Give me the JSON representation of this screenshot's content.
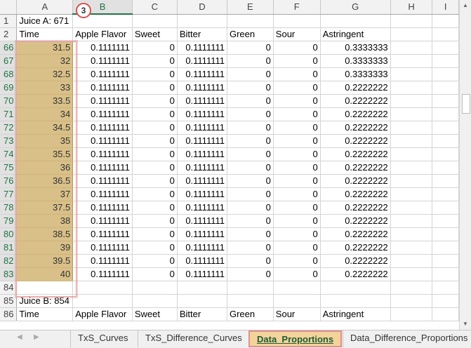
{
  "columns": [
    "A",
    "B",
    "C",
    "D",
    "E",
    "F",
    "G",
    "H",
    "I"
  ],
  "annotation_badge": "3",
  "header_rows": [
    {
      "row": "1",
      "cells": [
        "Juice A: 671",
        "",
        "",
        "",
        "",
        "",
        "",
        "",
        ""
      ]
    },
    {
      "row": "2",
      "cells": [
        "Time",
        "Apple Flavor",
        "Sweet",
        "Bitter",
        "Green",
        "Sour",
        "Astringent",
        "",
        ""
      ]
    }
  ],
  "data_rows": [
    {
      "row": "66",
      "time": "31.5",
      "apple": "0.1111111",
      "sweet": "0",
      "bitter": "0.1111111",
      "green": "0",
      "sour": "0",
      "astringent": "0.3333333"
    },
    {
      "row": "67",
      "time": "32",
      "apple": "0.1111111",
      "sweet": "0",
      "bitter": "0.1111111",
      "green": "0",
      "sour": "0",
      "astringent": "0.3333333"
    },
    {
      "row": "68",
      "time": "32.5",
      "apple": "0.1111111",
      "sweet": "0",
      "bitter": "0.1111111",
      "green": "0",
      "sour": "0",
      "astringent": "0.3333333"
    },
    {
      "row": "69",
      "time": "33",
      "apple": "0.1111111",
      "sweet": "0",
      "bitter": "0.1111111",
      "green": "0",
      "sour": "0",
      "astringent": "0.2222222"
    },
    {
      "row": "70",
      "time": "33.5",
      "apple": "0.1111111",
      "sweet": "0",
      "bitter": "0.1111111",
      "green": "0",
      "sour": "0",
      "astringent": "0.2222222"
    },
    {
      "row": "71",
      "time": "34",
      "apple": "0.1111111",
      "sweet": "0",
      "bitter": "0.1111111",
      "green": "0",
      "sour": "0",
      "astringent": "0.2222222"
    },
    {
      "row": "72",
      "time": "34.5",
      "apple": "0.1111111",
      "sweet": "0",
      "bitter": "0.1111111",
      "green": "0",
      "sour": "0",
      "astringent": "0.2222222"
    },
    {
      "row": "73",
      "time": "35",
      "apple": "0.1111111",
      "sweet": "0",
      "bitter": "0.1111111",
      "green": "0",
      "sour": "0",
      "astringent": "0.2222222"
    },
    {
      "row": "74",
      "time": "35.5",
      "apple": "0.1111111",
      "sweet": "0",
      "bitter": "0.1111111",
      "green": "0",
      "sour": "0",
      "astringent": "0.2222222"
    },
    {
      "row": "75",
      "time": "36",
      "apple": "0.1111111",
      "sweet": "0",
      "bitter": "0.1111111",
      "green": "0",
      "sour": "0",
      "astringent": "0.2222222"
    },
    {
      "row": "76",
      "time": "36.5",
      "apple": "0.1111111",
      "sweet": "0",
      "bitter": "0.1111111",
      "green": "0",
      "sour": "0",
      "astringent": "0.2222222"
    },
    {
      "row": "77",
      "time": "37",
      "apple": "0.1111111",
      "sweet": "0",
      "bitter": "0.1111111",
      "green": "0",
      "sour": "0",
      "astringent": "0.2222222"
    },
    {
      "row": "78",
      "time": "37.5",
      "apple": "0.1111111",
      "sweet": "0",
      "bitter": "0.1111111",
      "green": "0",
      "sour": "0",
      "astringent": "0.2222222"
    },
    {
      "row": "79",
      "time": "38",
      "apple": "0.1111111",
      "sweet": "0",
      "bitter": "0.1111111",
      "green": "0",
      "sour": "0",
      "astringent": "0.2222222"
    },
    {
      "row": "80",
      "time": "38.5",
      "apple": "0.1111111",
      "sweet": "0",
      "bitter": "0.1111111",
      "green": "0",
      "sour": "0",
      "astringent": "0.2222222"
    },
    {
      "row": "81",
      "time": "39",
      "apple": "0.1111111",
      "sweet": "0",
      "bitter": "0.1111111",
      "green": "0",
      "sour": "0",
      "astringent": "0.2222222"
    },
    {
      "row": "82",
      "time": "39.5",
      "apple": "0.1111111",
      "sweet": "0",
      "bitter": "0.1111111",
      "green": "0",
      "sour": "0",
      "astringent": "0.2222222"
    },
    {
      "row": "83",
      "time": "40",
      "apple": "0.1111111",
      "sweet": "0",
      "bitter": "0.1111111",
      "green": "0",
      "sour": "0",
      "astringent": "0.2222222"
    }
  ],
  "footer_rows": [
    {
      "row": "84",
      "cells": [
        "",
        "",
        "",
        "",
        "",
        "",
        "",
        "",
        ""
      ]
    },
    {
      "row": "85",
      "cells": [
        "Juice B: 854",
        "",
        "",
        "",
        "",
        "",
        "",
        "",
        ""
      ]
    },
    {
      "row": "86",
      "cells": [
        "Time",
        "Apple Flavor",
        "Sweet",
        "Bitter",
        "Green",
        "Sour",
        "Astringent",
        "",
        ""
      ]
    }
  ],
  "sheet_tabs": [
    {
      "label": "TxS_Curves",
      "active": false
    },
    {
      "label": "TxS_Difference_Curves",
      "active": false
    },
    {
      "label": "Data_Proportions",
      "active": true
    },
    {
      "label": "Data_Difference_Proportions",
      "active": false
    }
  ],
  "colors": {
    "selection_fill": "#d9c089",
    "active_header": "#217346",
    "annotation_red": "#d9534f"
  }
}
